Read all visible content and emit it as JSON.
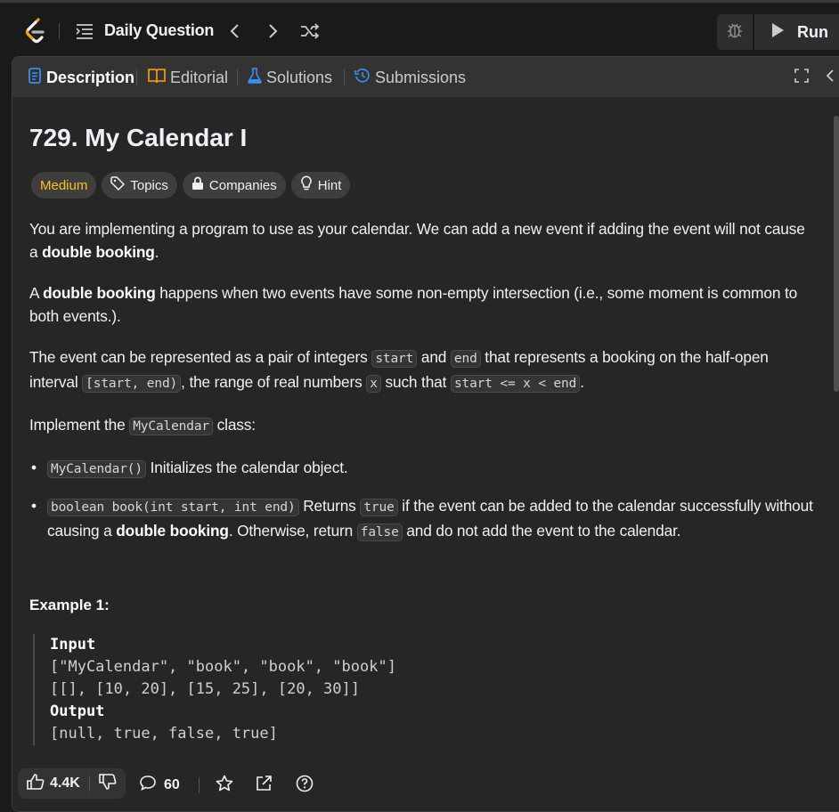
{
  "topbar": {
    "title": "Daily Question",
    "run_label": "Run",
    "icons": [
      "leetcode-logo",
      "list-icon",
      "chevron-left-icon",
      "chevron-right-icon",
      "shuffle-icon",
      "bug-icon",
      "play-icon"
    ]
  },
  "tabs": [
    {
      "label": "Description",
      "icon": "document-icon",
      "active": true
    },
    {
      "label": "Editorial",
      "icon": "book-icon",
      "active": false
    },
    {
      "label": "Solutions",
      "icon": "flask-icon",
      "active": false
    },
    {
      "label": "Submissions",
      "icon": "history-icon",
      "active": false
    }
  ],
  "problem": {
    "title": "729. My Calendar I",
    "tags": {
      "difficulty": "Medium",
      "topics": "Topics",
      "companies": "Companies",
      "hint": "Hint"
    },
    "difficulty_color": "#ffc01e",
    "p1": {
      "t1": "You are implementing a program to use as your calendar. We can add a new event if adding the event will not cause a ",
      "b1": "double booking",
      "t2": "."
    },
    "p2": {
      "t0": "A ",
      "b1": "double booking",
      "t1": " happens when two events have some non-empty intersection (i.e., some moment is common to both events.)."
    },
    "p3": {
      "t1": "The event can be represented as a pair of integers ",
      "c1": "start",
      "t2": " and ",
      "c2": "end",
      "t3": " that represents a booking on the half-open interval ",
      "c3": "[start, end)",
      "t4": ", the range of real numbers ",
      "c4": "x",
      "t5": " such that ",
      "c5": "start <= x < end",
      "t6": "."
    },
    "p4": {
      "t1": "Implement the ",
      "c1": "MyCalendar",
      "t2": " class:"
    },
    "bullet1": {
      "c1": "MyCalendar()",
      "t1": " Initializes the calendar object."
    },
    "bullet2": {
      "c1": "boolean book(int start, int end)",
      "t1": " Returns ",
      "c2": "true",
      "t2": " if the event can be added to the calendar successfully without causing a ",
      "b1": "double booking",
      "t3": ". Otherwise, return ",
      "c3": "false",
      "t4": " and do not add the event to the calendar."
    },
    "example": {
      "heading": "Example 1:",
      "input_label": "Input",
      "input_line1": "[\"MyCalendar\", \"book\", \"book\", \"book\"]",
      "input_line2": "[[], [10, 20], [15, 25], [20, 30]]",
      "output_label": "Output",
      "output_line1": "[null, true, false, true]"
    }
  },
  "bottombar": {
    "likes": "4.4K",
    "comments": "60"
  }
}
